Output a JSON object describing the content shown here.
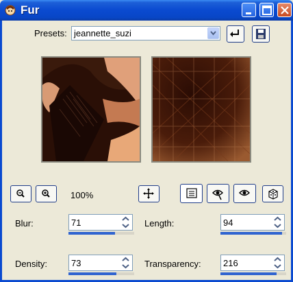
{
  "window": {
    "title": "Fur"
  },
  "presets": {
    "label": "Presets:",
    "value": "jeannette_suzi"
  },
  "zoom": {
    "level": "100%"
  },
  "params": {
    "blur": {
      "label": "Blur:",
      "value": "71",
      "fraction": 0.71
    },
    "length": {
      "label": "Length:",
      "value": "94",
      "fraction": 0.94
    },
    "density": {
      "label": "Density:",
      "value": "73",
      "fraction": 0.73
    },
    "transparency": {
      "label": "Transparency:",
      "value": "216",
      "fraction": 0.85
    }
  },
  "colors": {
    "titlebar": "#0a4ad0",
    "dialog_bg": "#ece9d8",
    "accent": "#3064d0"
  },
  "icons": [
    "fur-app-icon",
    "minimize-icon",
    "maximize-icon",
    "close-icon",
    "chevron-down-icon",
    "reset-icon",
    "save-preset-icon",
    "zoom-out-icon",
    "zoom-in-icon",
    "pan-icon",
    "list-icon",
    "proof-icon",
    "preview-eye-icon",
    "randomize-dice-icon"
  ]
}
